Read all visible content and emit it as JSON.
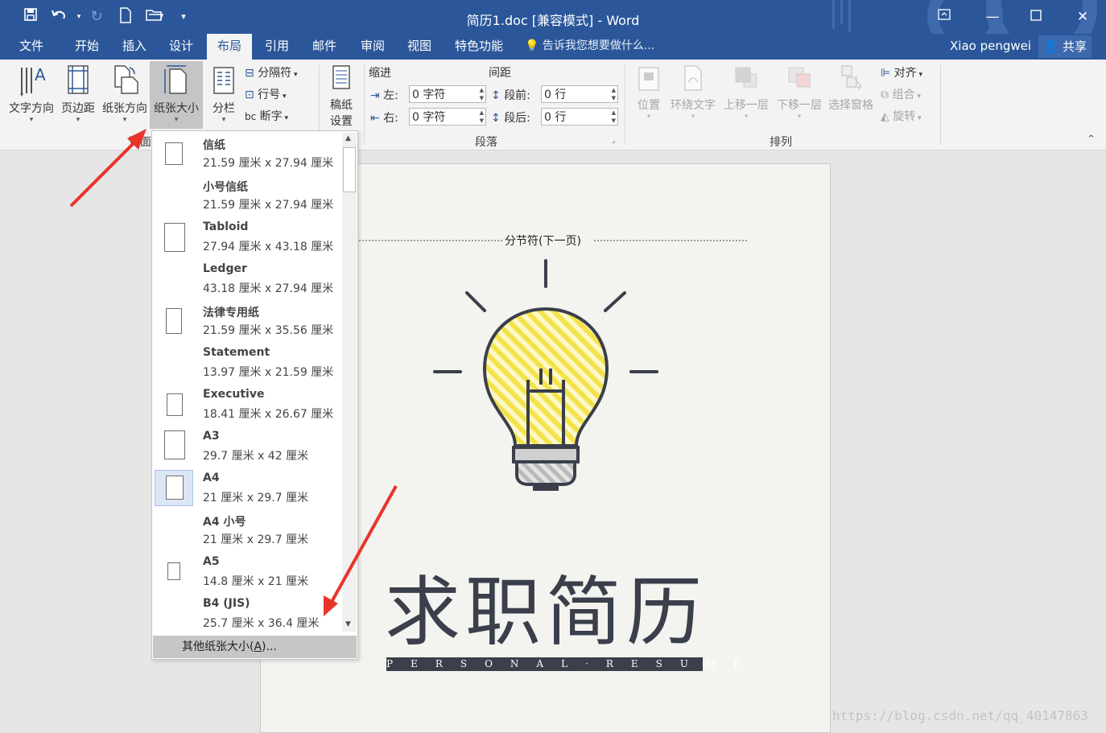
{
  "window": {
    "title": "简历1.doc [兼容模式] - Word",
    "minimize_icon": "minimize-icon",
    "maximize_icon": "maximize-icon",
    "close_icon": "close-icon",
    "ribbon_display_icon": "ribbon-display-options-icon"
  },
  "quick_access": [
    "save-icon",
    "undo-icon",
    "redo-icon",
    "new-document-icon",
    "open-folder-icon",
    "customize-icon"
  ],
  "tabs": [
    "文件",
    "开始",
    "插入",
    "设计",
    "布局",
    "引用",
    "邮件",
    "审阅",
    "视图",
    "特色功能"
  ],
  "active_tab": "布局",
  "tell_me": "告诉我您想要做什么...",
  "user": "Xiao pengwei",
  "share": "共享",
  "ribbon": {
    "page_setup": {
      "text_direction": "文字方向",
      "margins": "页边距",
      "orientation": "纸张方向",
      "size": "纸张大小",
      "columns": "分栏",
      "breaks": "分隔符",
      "line_numbers": "行号",
      "hyphenation": "断字",
      "group_label_fragment": "页面"
    },
    "manuscript": {
      "line1": "稿纸",
      "line2": "设置"
    },
    "paragraph": {
      "indent_label": "缩进",
      "spacing_label": "间距",
      "left_label": "左:",
      "right_label": "右:",
      "before_label": "段前:",
      "after_label": "段后:",
      "left_value": "0 字符",
      "right_value": "0 字符",
      "before_value": "0 行",
      "after_value": "0 行",
      "group_label": "段落"
    },
    "arrange": {
      "position": "位置",
      "wrap_text": "环绕文字",
      "bring_forward": "上移一层",
      "send_backward": "下移一层",
      "selection_pane": "选择窗格",
      "align": "对齐",
      "group": "组合",
      "rotate": "旋转",
      "group_label": "排列"
    }
  },
  "paper_sizes": [
    {
      "name": "信纸",
      "size": "21.59 厘米 x 27.94 厘米"
    },
    {
      "name": "小号信纸",
      "size": "21.59 厘米 x 27.94 厘米"
    },
    {
      "name": "Tabloid",
      "size": "27.94 厘米 x 43.18 厘米"
    },
    {
      "name": "Ledger",
      "size": "43.18 厘米 x 27.94 厘米"
    },
    {
      "name": "法律专用纸",
      "size": "21.59 厘米 x 35.56 厘米"
    },
    {
      "name": "Statement",
      "size": "13.97 厘米 x 21.59 厘米"
    },
    {
      "name": "Executive",
      "size": "18.41 厘米 x 26.67 厘米"
    },
    {
      "name": "A3",
      "size": "29.7 厘米 x 42 厘米"
    },
    {
      "name": "A4",
      "size": "21 厘米 x 29.7 厘米"
    },
    {
      "name": "A4 小号",
      "size": "21 厘米 x 29.7 厘米"
    },
    {
      "name": "A5",
      "size": "14.8 厘米 x 21 厘米"
    },
    {
      "name": "B4 (JIS)",
      "size": "25.7 厘米 x 36.4 厘米"
    }
  ],
  "selected_paper": "A4",
  "more_sizes": {
    "text": "其他纸张大小(",
    "key": "A",
    "suffix": ")..."
  },
  "document": {
    "section_break": "分节符(下一页)",
    "title": "求职简历",
    "subtitle": "PERSONAL·RESUME"
  },
  "watermark": "https://blog.csdn.net/qq_40147863",
  "colors": {
    "word_blue": "#2b579a",
    "bulb_yellow": "#f3e24a",
    "dark_ink": "#3a3f4b",
    "annotation_red": "#e8352b"
  }
}
